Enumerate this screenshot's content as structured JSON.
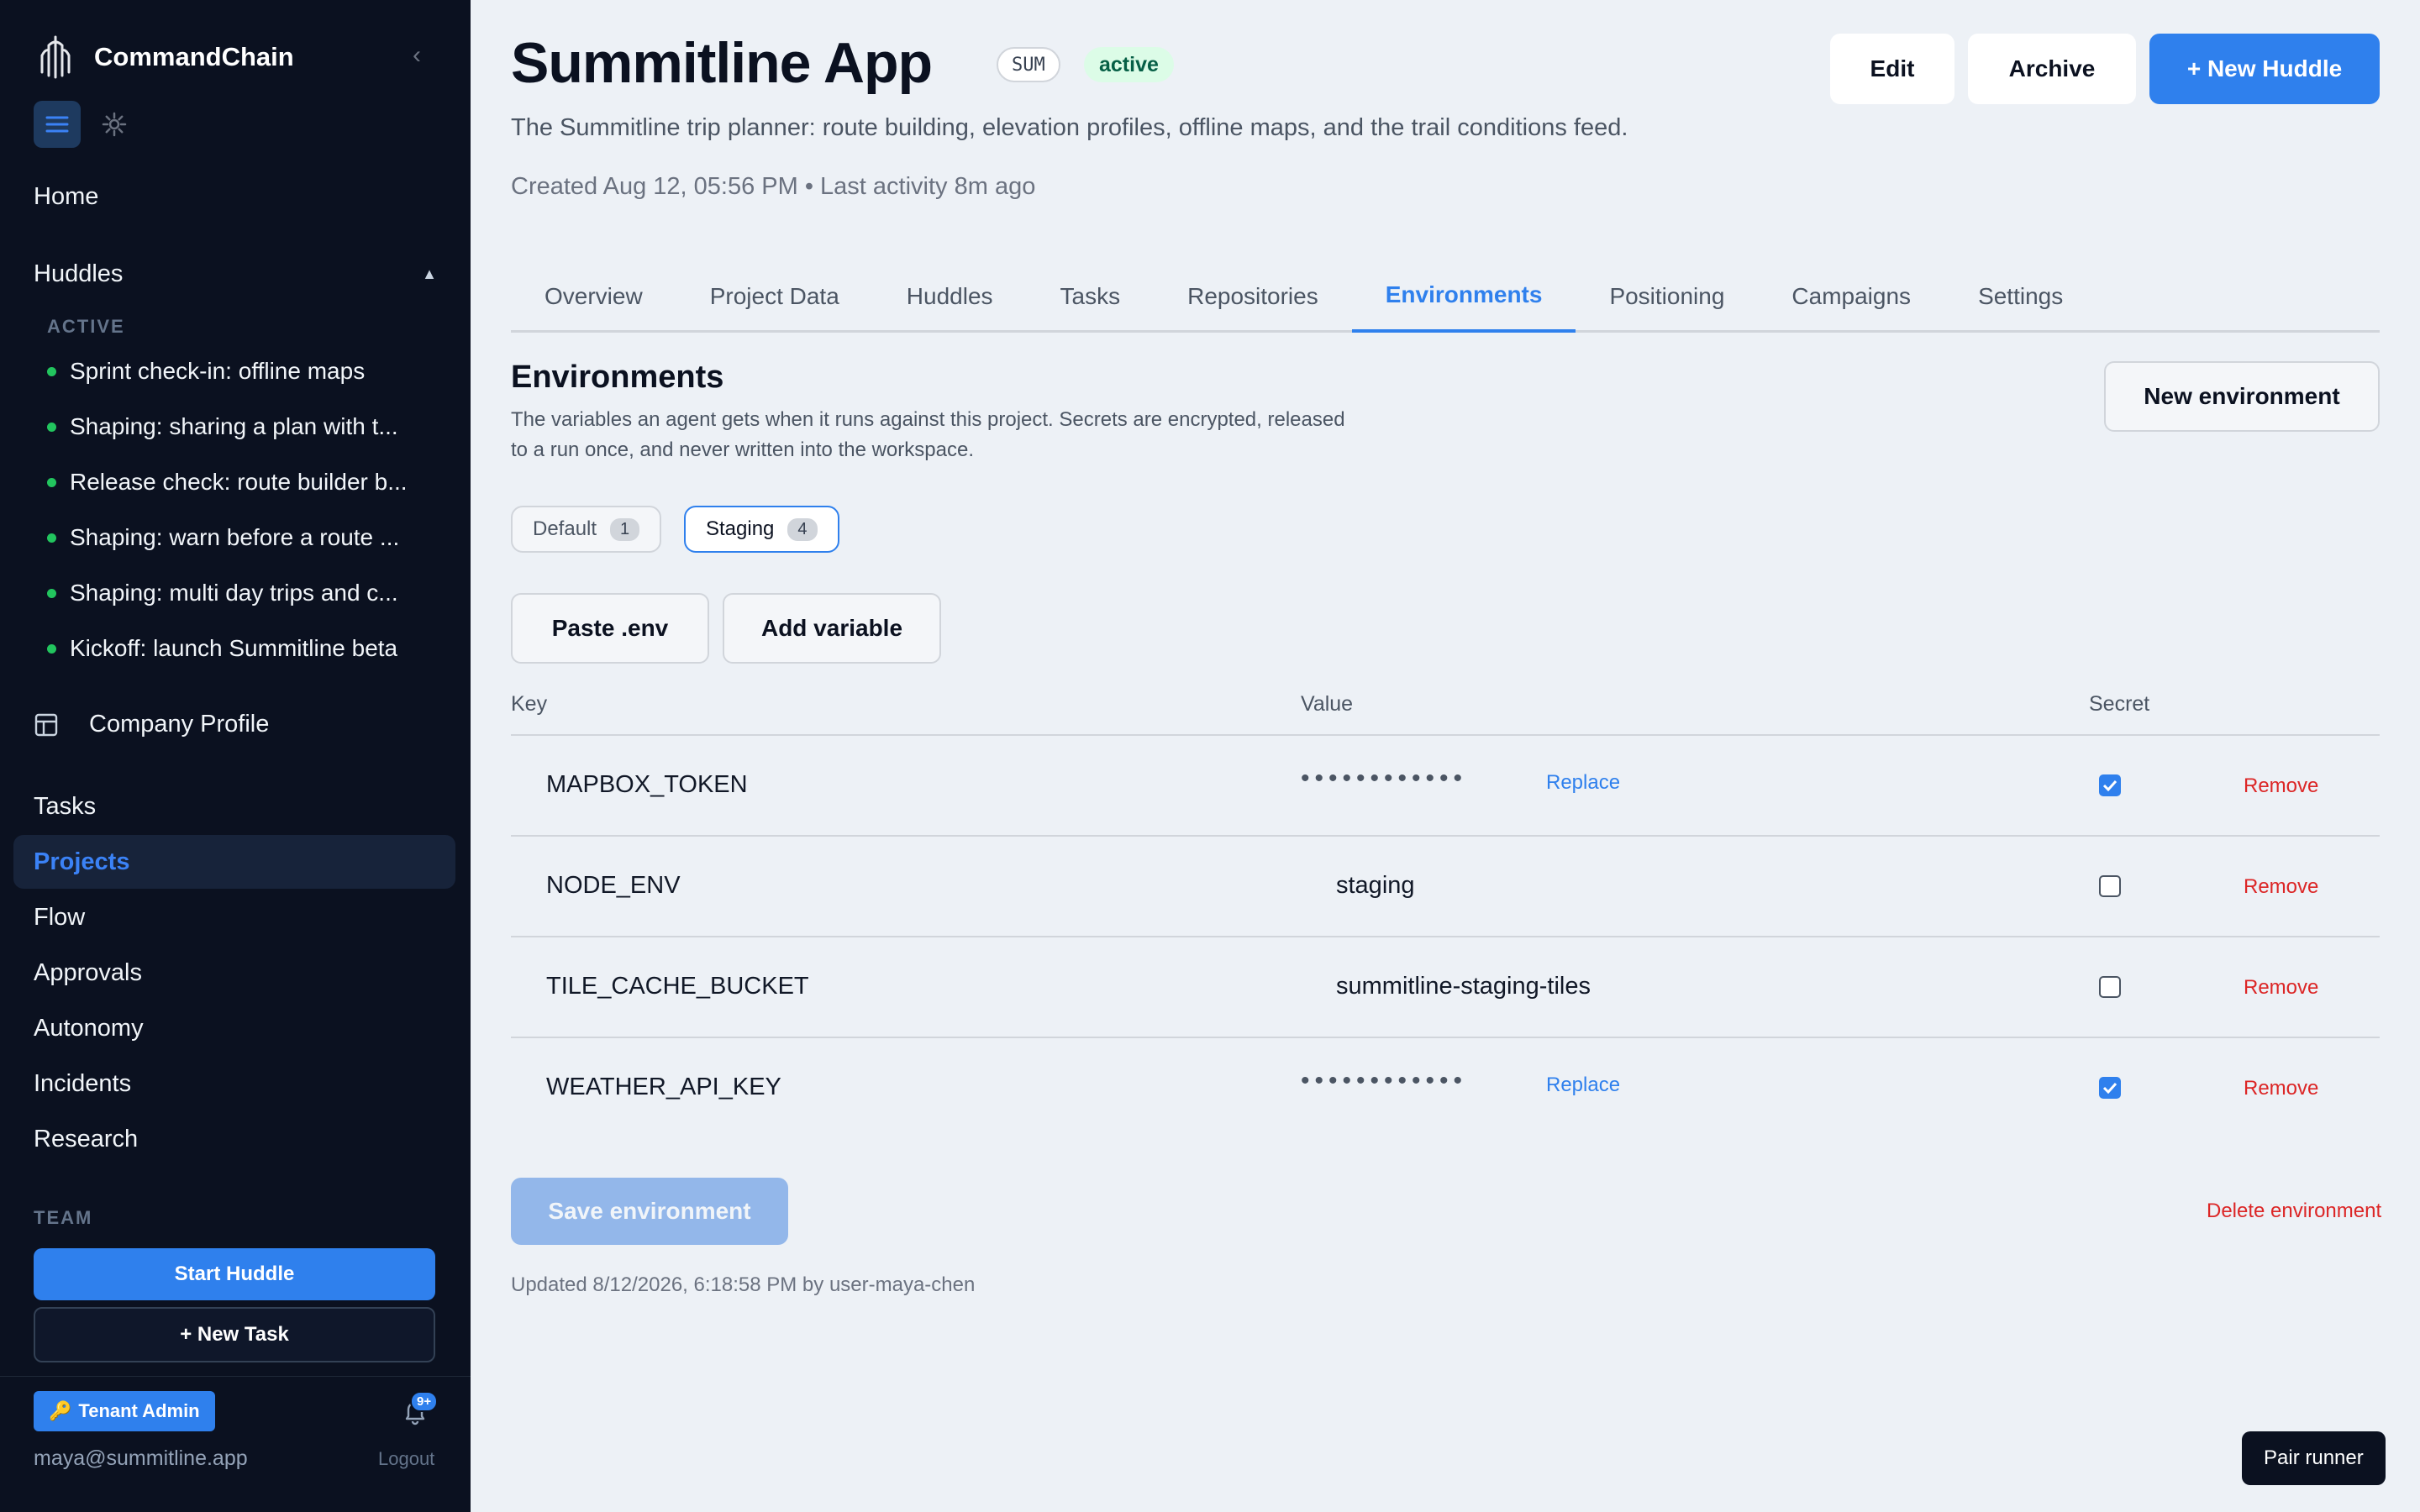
{
  "sidebar": {
    "brand": "CommandChain",
    "nav_top": {
      "home": "Home"
    },
    "huddles": {
      "label": "Huddles",
      "active_label": "ACTIVE",
      "items": [
        "Sprint check-in: offline maps",
        "Shaping: sharing a plan with t...",
        "Release check: route builder b...",
        "Shaping: warn before a route ...",
        "Shaping: multi day trips and c...",
        "Kickoff: launch Summitline beta"
      ]
    },
    "company_profile": "Company Profile",
    "nav": {
      "tasks": "Tasks",
      "projects": "Projects",
      "flow": "Flow",
      "approvals": "Approvals",
      "autonomy": "Autonomy",
      "incidents": "Incidents",
      "research": "Research"
    },
    "team_label": "TEAM",
    "start_huddle": "Start Huddle",
    "new_task": "+ New Task",
    "tenant_admin": "Tenant Admin",
    "notification_count": "9+",
    "user_email": "maya@summitline.app",
    "logout": "Logout"
  },
  "project": {
    "title": "Summitline App",
    "code": "SUM",
    "status": "active",
    "description": "The Summitline trip planner: route building, elevation profiles, offline maps, and the trail conditions feed.",
    "meta": "Created Aug 12, 05:56 PM • Last activity 8m ago"
  },
  "header_buttons": {
    "edit": "Edit",
    "archive": "Archive",
    "new_huddle": "+ New Huddle"
  },
  "tabs": [
    "Overview",
    "Project Data",
    "Huddles",
    "Tasks",
    "Repositories",
    "Environments",
    "Positioning",
    "Campaigns",
    "Settings"
  ],
  "active_tab": "Environments",
  "environments": {
    "title": "Environments",
    "description": "The variables an agent gets when it runs against this project. Secrets are encrypted, released to a run once, and never written into the workspace.",
    "new_button": "New environment",
    "envs": [
      {
        "name": "Default",
        "count": "1"
      },
      {
        "name": "Staging",
        "count": "4"
      }
    ],
    "paste_env": "Paste .env",
    "add_variable": "Add variable",
    "columns": {
      "key": "Key",
      "value": "Value",
      "secret": "Secret"
    },
    "variables": [
      {
        "key": "MAPBOX_TOKEN",
        "value": "••••••••••••",
        "secret": true,
        "replace": "Replace",
        "remove": "Remove"
      },
      {
        "key": "NODE_ENV",
        "value": "staging",
        "secret": false,
        "remove": "Remove"
      },
      {
        "key": "TILE_CACHE_BUCKET",
        "value": "summitline-staging-tiles",
        "secret": false,
        "remove": "Remove"
      },
      {
        "key": "WEATHER_API_KEY",
        "value": "••••••••••••",
        "secret": true,
        "replace": "Replace",
        "remove": "Remove"
      }
    ],
    "save": "Save environment",
    "delete": "Delete environment",
    "updated": "Updated 8/12/2026, 6:18:58 PM by user-maya-chen"
  },
  "pair_runner": "Pair runner",
  "colors": {
    "accent": "#2f80ed",
    "sidebar_bg": "#0b1120",
    "danger": "#dc2626",
    "success": "#22c55e"
  }
}
